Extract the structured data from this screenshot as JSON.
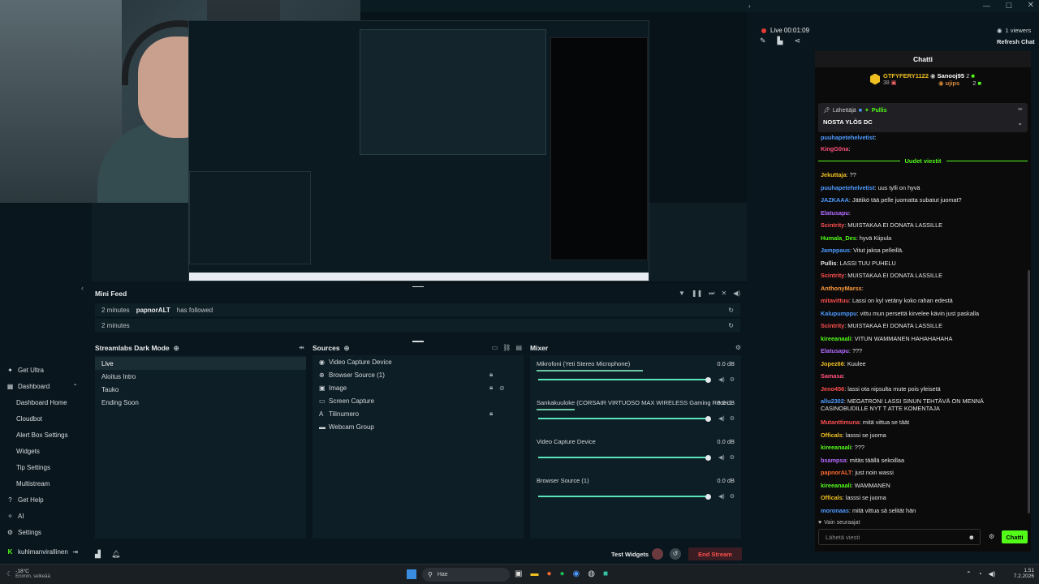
{
  "colors": {
    "accent": "#31c3a2",
    "stream_end": "#ff4f4f",
    "chat_send": "#53fc18",
    "live_dot": "#e53935"
  },
  "top": {
    "live_label": "Live 00:01:09",
    "viewers": "1 viewers",
    "refresh": "Refresh Chat"
  },
  "sidebar": {
    "get_ultra": "Get Ultra",
    "dashboard": "Dashboard",
    "sub": [
      "Dashboard Home",
      "Cloudbot",
      "Alert Box Settings",
      "Widgets",
      "Tip Settings",
      "Multistream"
    ],
    "get_help": "Get Help",
    "ai": "AI",
    "settings": "Settings",
    "user": "kuhlmanvirallinen"
  },
  "minifeed": {
    "title": "Mini Feed",
    "rows": [
      {
        "time": "2 minutes",
        "user": "papnorALT",
        "action": "has followed"
      },
      {
        "time": "2 minutes",
        "user": "",
        "action": ""
      }
    ]
  },
  "scenes": {
    "title": "Streamlabs Dark Mode",
    "items": [
      "Live",
      "Aloitus Intro",
      "Tauko",
      "Ending Soon"
    ]
  },
  "sources": {
    "title": "Sources",
    "items": [
      {
        "icon": "webcam-icon",
        "label": "Video Capture Device"
      },
      {
        "icon": "globe-icon",
        "label": "Browser Source (1)"
      },
      {
        "icon": "image-icon",
        "label": "Image"
      },
      {
        "icon": "monitor-icon",
        "label": "Screen Capture"
      },
      {
        "icon": "text-icon",
        "label": "Tilinumero"
      },
      {
        "icon": "folder-icon",
        "label": "Webcam Group"
      }
    ]
  },
  "mixer": {
    "title": "Mixer",
    "channels": [
      {
        "name": "Mikrofoni (Yeti Stereo Microphone)",
        "db": "0.0 dB",
        "level": 0.62
      },
      {
        "name": "Sankakuuloke (CORSAIR VIRTUOSO MAX WIRELESS Gaming Recei...",
        "db": "0.0 dB",
        "level": 0.22
      },
      {
        "name": "Video Capture Device",
        "db": "0.0 dB",
        "level": 0
      },
      {
        "name": "Browser Source (1)",
        "db": "0.0 dB",
        "level": 0
      }
    ]
  },
  "bottom": {
    "test_widgets": "Test Widgets",
    "end_stream": "End Stream"
  },
  "chat": {
    "title": "Chatti",
    "gifter1": {
      "name": "GTFYFERY1122",
      "count": "38"
    },
    "gifter2": {
      "name": "Sanooj95",
      "count": "2",
      "sub": "ujips",
      "subcount": "2"
    },
    "pinned": {
      "sender_label": "Lähettäjä",
      "sender": "Pullis",
      "message": "NOSTA YLÖS DC"
    },
    "pre": [
      {
        "user": "puuhapetehelvetist",
        "text": "",
        "color": "#4e9cff"
      },
      {
        "user": "KingG0na",
        "text": "",
        "color": "#ff4f7a"
      }
    ],
    "new_label": "Uudet viestit",
    "messages": [
      {
        "user": "Jekuttaja",
        "text": "??",
        "color": "#f0c020"
      },
      {
        "user": "puuhapetehelvetist",
        "text": "uus tylli on hyvä",
        "color": "#4e9cff"
      },
      {
        "user": "JAZKAAA",
        "text": "Jättikö tää pelle juomatta subatut juomat?",
        "color": "#4e9cff"
      },
      {
        "user": "Elatusapu",
        "text": "",
        "color": "#b36bff"
      },
      {
        "user": "Scintrity",
        "text": "MUISTAKAA EI DONATA LASSILLE",
        "color": "#ff4f4f"
      },
      {
        "user": "Humala_Des",
        "text": "hyvä Kiipula",
        "color": "#53fc18"
      },
      {
        "user": "Jamppaus",
        "text": "Vitut jaksa pelleillä.",
        "color": "#4e9cff"
      },
      {
        "user": "Pullis",
        "text": "LASSI TUU PUHELU",
        "color": "#e5e5e5"
      },
      {
        "user": "Scintrity",
        "text": "MUISTAKAA EI DONATA LASSILLE",
        "color": "#ff4f4f"
      },
      {
        "user": "AnthonyMarss",
        "text": "",
        "color": "#ff9a3c"
      },
      {
        "user": "mitavittuu",
        "text": "Lassi on kyl vetäny koko rahan edestä",
        "color": "#ff4f4f"
      },
      {
        "user": "Kalupumppu",
        "text": "vittu mun persettä kirvelee kävin just paskalla",
        "color": "#4e9cff"
      },
      {
        "user": "Scintrity",
        "text": "MUISTAKAA EI DONATA LASSILLE",
        "color": "#ff4f4f"
      },
      {
        "user": "kireeanaali",
        "text": "VITUN WAMMANEN HAHAHAHAHA",
        "color": "#53fc18"
      },
      {
        "user": "Elatusapu",
        "text": "???",
        "color": "#b36bff"
      },
      {
        "user": "Jopez66",
        "text": "Kuulee",
        "color": "#f0c020"
      },
      {
        "user": "Samasa",
        "text": "",
        "color": "#ff4f7a"
      },
      {
        "user": "Jeno456",
        "text": "lassi ota nipsulta mute pois yleisetä",
        "color": "#ff4f4f"
      },
      {
        "user": "allu2302",
        "text": "MEGATRONI LASSI SINUN TEHTÄVÄ ON MENNÄ CASINOBUDILLE NYT T ATTE KOMENTAJA",
        "color": "#4e9cff"
      },
      {
        "user": "Mutanttimuna",
        "text": "mitä vittua se täät",
        "color": "#ff4f4f"
      },
      {
        "user": "Officals",
        "text": "lasssi se juoma",
        "color": "#f0c020"
      },
      {
        "user": "kireeanaali",
        "text": "???",
        "color": "#53fc18"
      },
      {
        "user": "bsampsa",
        "text": "mitäs täällä sekoillaa",
        "color": "#b36bff"
      },
      {
        "user": "papnorALT",
        "text": "just noin wassi",
        "color": "#ff6b2d"
      },
      {
        "user": "kireeanaali",
        "text": "WAMMANEN",
        "color": "#53fc18"
      },
      {
        "user": "Officals",
        "text": "lasssi se juoma",
        "color": "#f0c020"
      },
      {
        "user": "moronaas",
        "text": "mitä vittua sä selität hän",
        "color": "#4e9cff"
      }
    ],
    "followers_only": "Vain seuraajat",
    "placeholder": "Lähetä viesti",
    "send": "Chatti"
  },
  "taskbar": {
    "weather": "-18°C",
    "weather_sub": "Enimm. selkeää",
    "search": "Hae",
    "time": "1.51",
    "date": "7.2.2026"
  }
}
